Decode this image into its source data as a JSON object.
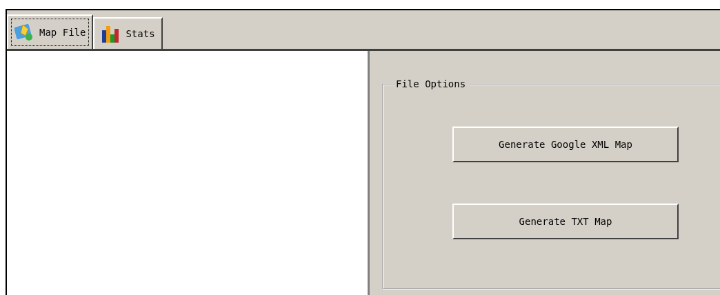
{
  "tabs": [
    {
      "label": "Map File",
      "kind": "map",
      "selected": true
    },
    {
      "label": "Stats",
      "kind": "chart",
      "selected": false
    }
  ],
  "group": {
    "title": "File Options",
    "buttons": [
      "Generate Google XML Map",
      "Generate TXT Map"
    ]
  }
}
